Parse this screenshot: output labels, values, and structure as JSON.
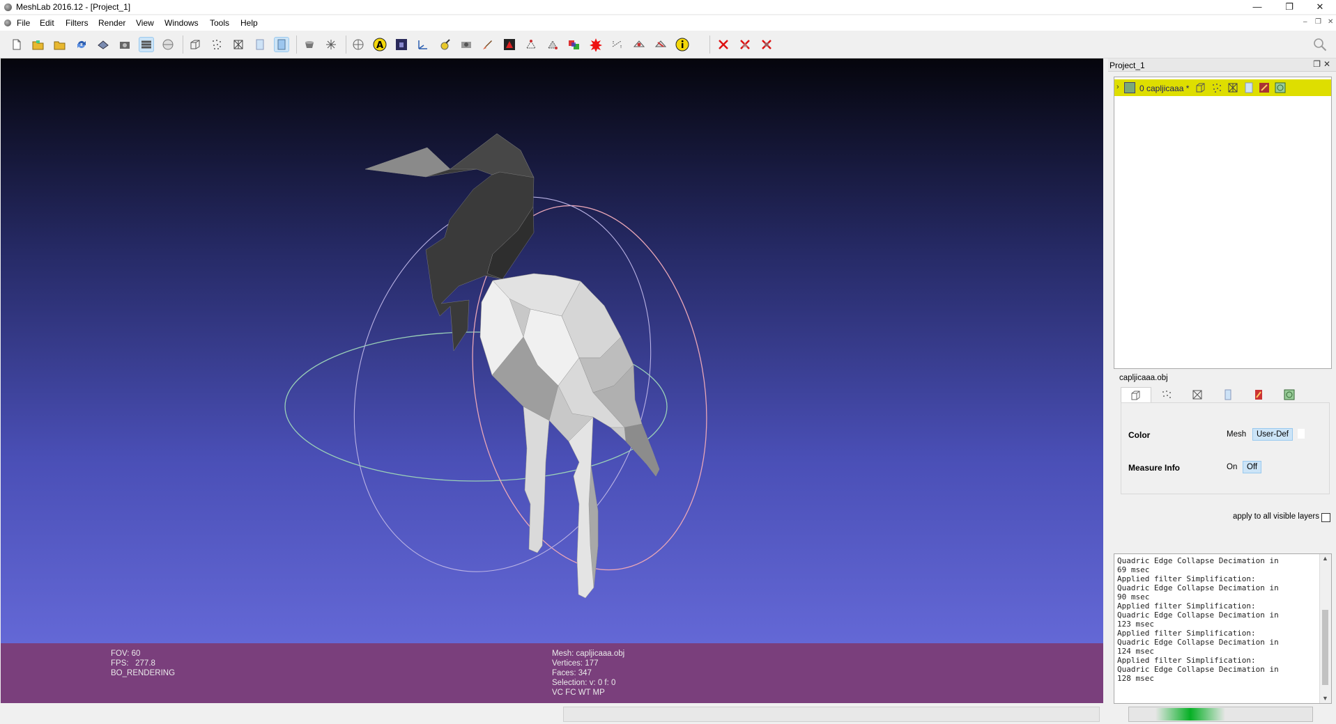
{
  "window": {
    "title": "MeshLab 2016.12 - [Project_1]",
    "minimize": "—",
    "restore": "❐",
    "close": "✕"
  },
  "menu": [
    "File",
    "Edit",
    "Filters",
    "Render",
    "View",
    "Windows",
    "Tools",
    "Help"
  ],
  "mdi_controls": {
    "minimize": "–",
    "restore": "❐",
    "close": "✕"
  },
  "toolbar_icons": [
    "new-project-icon",
    "open-project-icon",
    "open-mesh-icon",
    "reload-icon",
    "save-snapshot-icon",
    "snapshot-icon",
    "show-layers-icon",
    "decorate-icon",
    "bounding-box-icon",
    "points-icon",
    "wireframe-icon",
    "flat-lines-icon",
    "smooth-icon",
    "lighting-icon",
    "fancy-lighting-icon",
    "trackball-icon",
    "annotation-icon",
    "texture-icon",
    "axis-icon",
    "paint-icon",
    "camera-icon",
    "brush-icon",
    "select-red-icon",
    "select-vertices-icon",
    "select-faces-icon",
    "align-icon",
    "georef-icon",
    "measure-icon",
    "point-picking-icon",
    "select-conn-icon",
    "info-icon",
    "delete-vertices-icon",
    "delete-faces-icon",
    "delete-all-icon"
  ],
  "colors": {
    "viewport_top": "#05050c",
    "viewport_bottom": "#6c70e0",
    "infobar": "#7a3f7c",
    "layer_highlight": "#dede00",
    "mesh": "#d8d8d8"
  },
  "viewport_info": {
    "left": {
      "fov": "FOV: 60",
      "fps": "FPS:   277.8",
      "mode": "BO_RENDERING"
    },
    "center": {
      "mesh": "Mesh: capljicaaa.obj",
      "vertices": "Vertices: 177",
      "faces": "Faces: 347",
      "selection": "Selection: v: 0 f: 0",
      "flags": "VC FC WT MP"
    }
  },
  "layer_dock": {
    "title": "Project_1",
    "layer": {
      "label": "0  capljicaaa *"
    }
  },
  "properties": {
    "filename": "capljicaaa.obj",
    "color": {
      "label": "Color",
      "option1": "Mesh",
      "option2": "User-Def"
    },
    "measure": {
      "label": "Measure Info",
      "option1": "On",
      "option2": "Off"
    },
    "apply_all": "apply to all visible layers"
  },
  "log": "Quadric Edge Collapse Decimation in\n69 msec\nApplied filter Simplification:\nQuadric Edge Collapse Decimation in\n90 msec\nApplied filter Simplification:\nQuadric Edge Collapse Decimation in\n123 msec\nApplied filter Simplification:\nQuadric Edge Collapse Decimation in\n124 msec\nApplied filter Simplification:\nQuadric Edge Collapse Decimation in\n128 msec"
}
